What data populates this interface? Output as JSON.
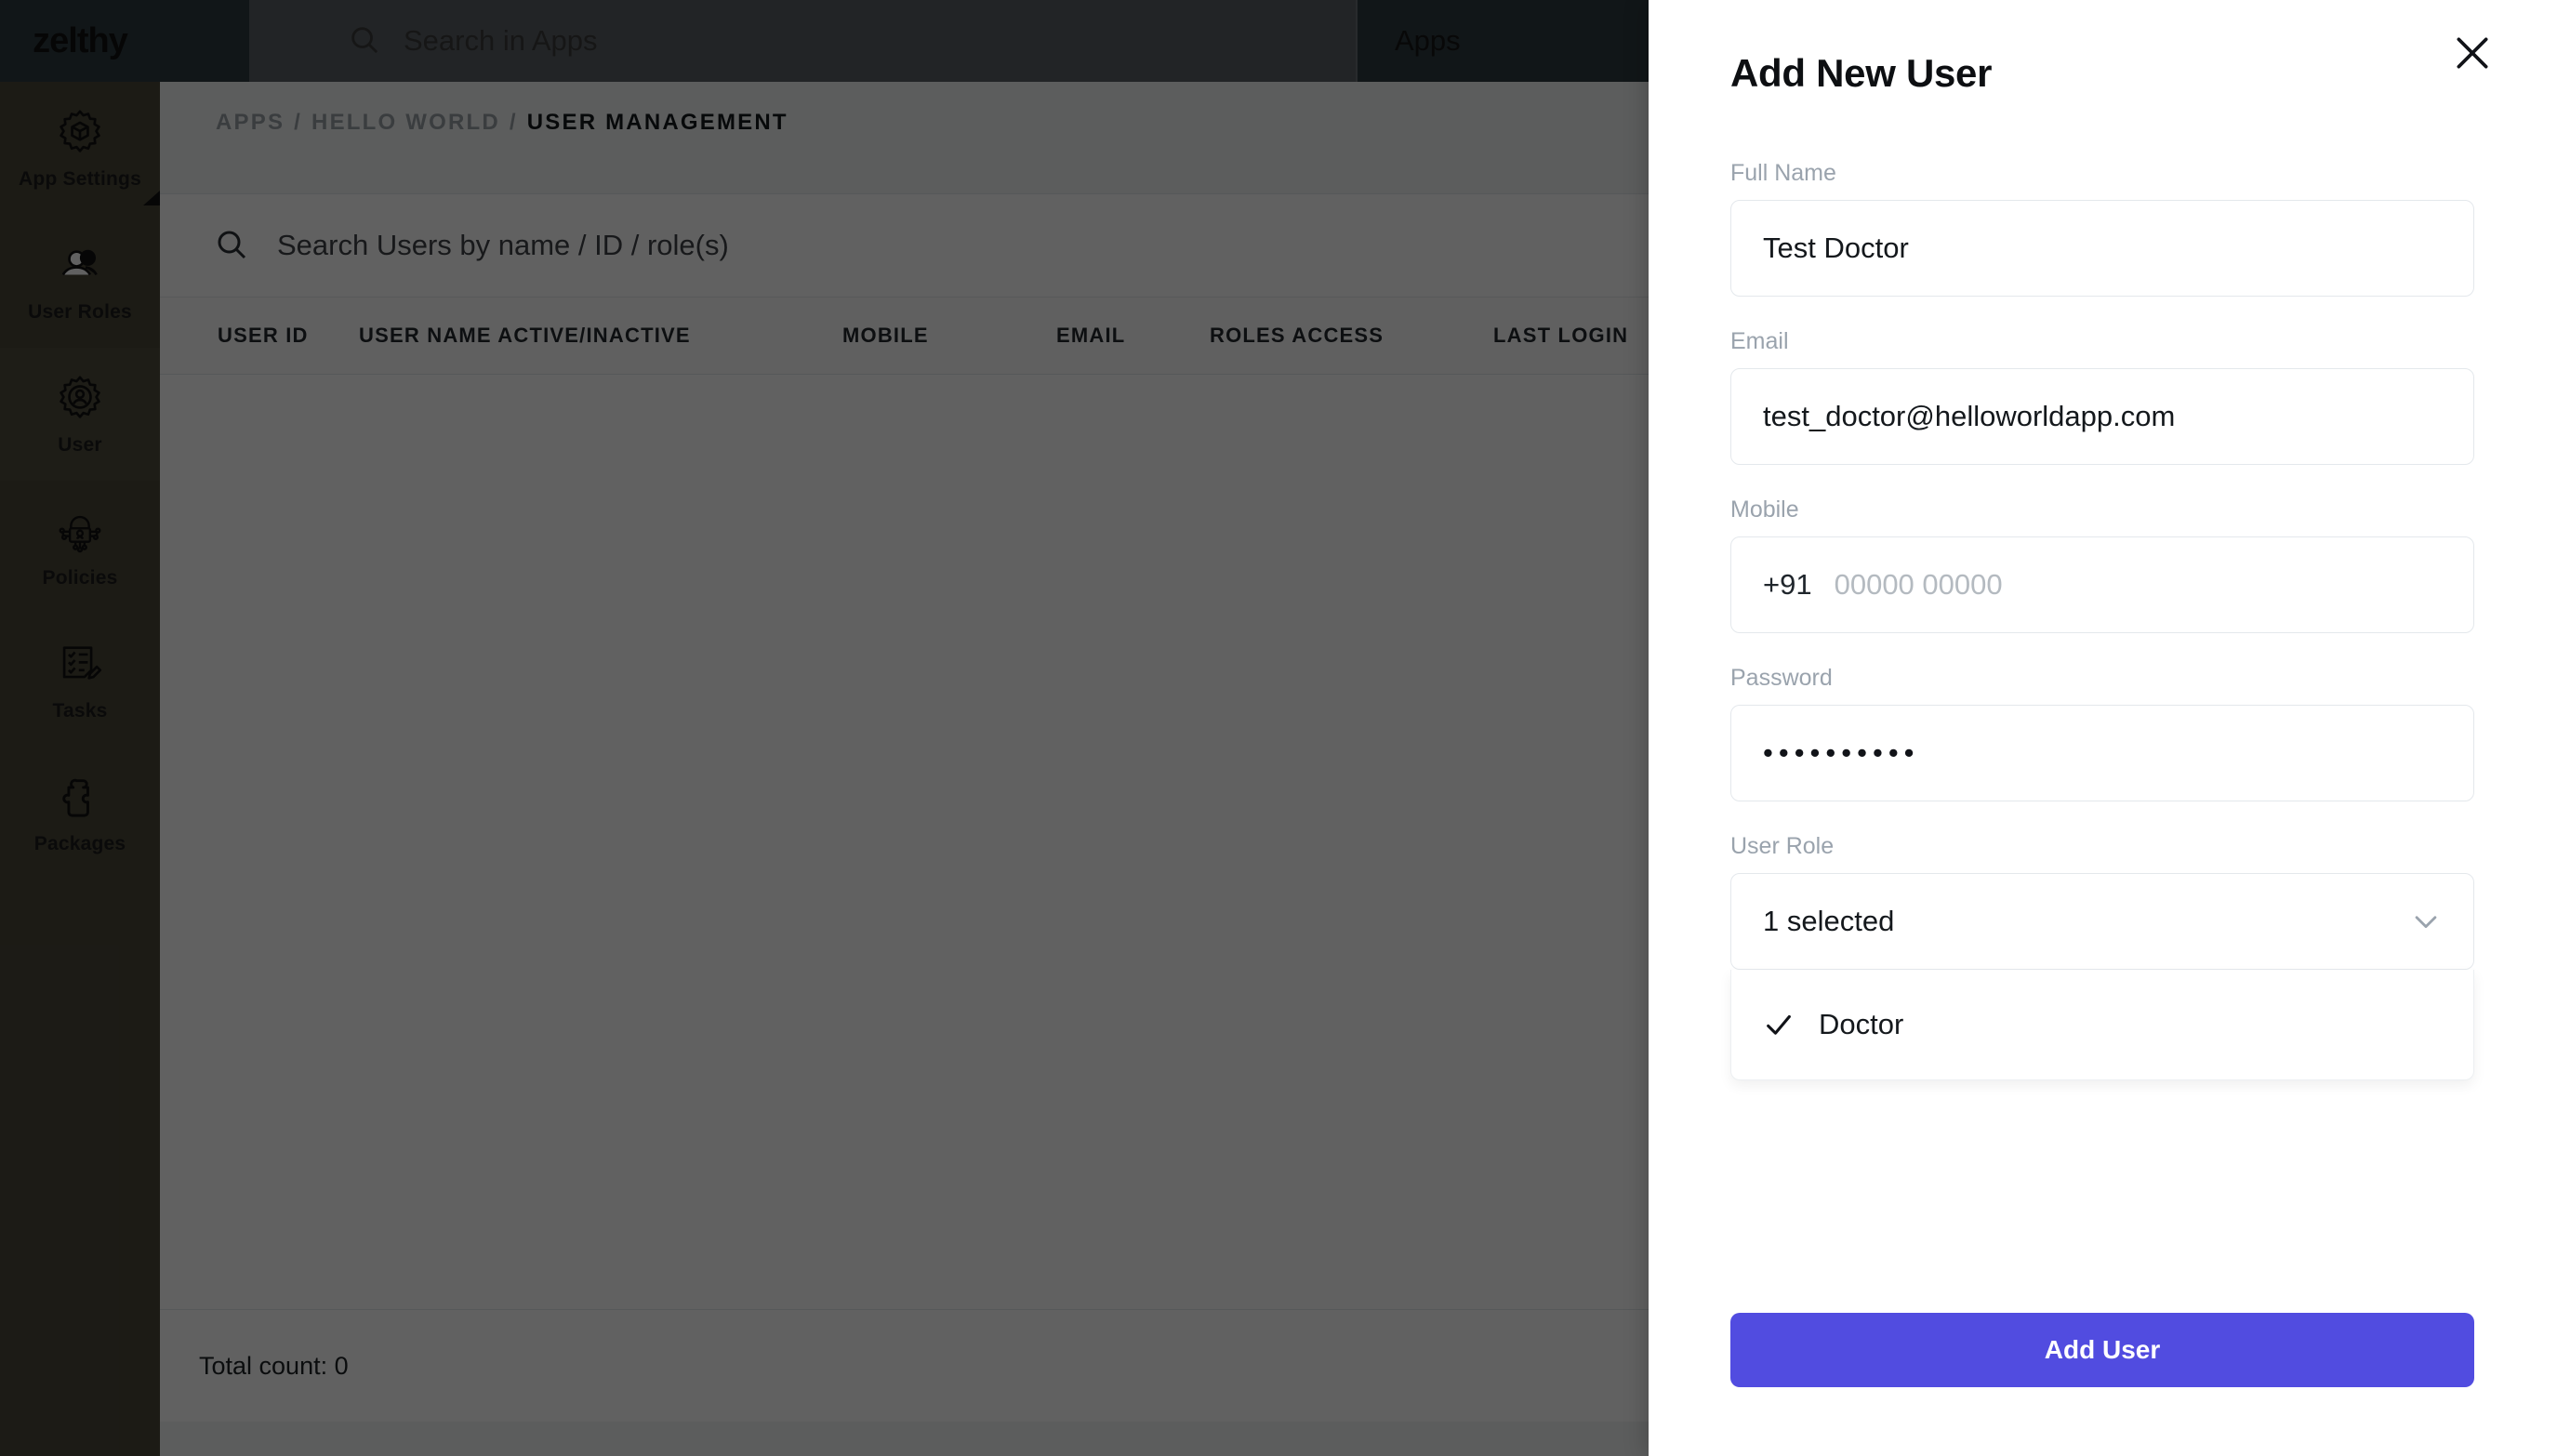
{
  "brand": "zelthy",
  "topbar": {
    "search_placeholder": "Search in Apps",
    "search_icon": "search-icon",
    "apps_label": "Apps"
  },
  "sidebar": {
    "items": [
      {
        "label": "App Settings",
        "icon": "gear-box-icon",
        "active": false,
        "caret": true
      },
      {
        "label": "User Roles",
        "icon": "users-icon",
        "active": false,
        "caret": false
      },
      {
        "label": "User",
        "icon": "gear-user-icon",
        "active": true,
        "caret": false
      },
      {
        "label": "Policies",
        "icon": "policy-shield-icon",
        "active": false,
        "caret": false
      },
      {
        "label": "Tasks",
        "icon": "checklist-pencil-icon",
        "active": false,
        "caret": false
      },
      {
        "label": "Packages",
        "icon": "puzzle-piece-icon",
        "active": false,
        "caret": false
      }
    ]
  },
  "breadcrumb": {
    "apps": "APPS",
    "sep1": "/",
    "app_name": "HELLO WORLD",
    "sep2": "/",
    "current": "USER MANAGEMENT"
  },
  "user_table": {
    "search_placeholder": "Search Users by name / ID / role(s)",
    "search_icon": "search-icon",
    "columns": [
      "USER ID",
      "USER NAME ACTIVE/INACTIVE",
      "MOBILE",
      "EMAIL",
      "ROLES ACCESS",
      "LAST LOGIN"
    ],
    "rows": [],
    "total_count_label": "Total count: 0"
  },
  "panel": {
    "title": "Add New User",
    "close_icon": "close-icon",
    "fields": {
      "full_name": {
        "label": "Full Name",
        "value": "Test Doctor",
        "placeholder": "Full Name"
      },
      "email": {
        "label": "Email",
        "value": "test_doctor@helloworldapp.com",
        "placeholder": "Email"
      },
      "mobile": {
        "label": "Mobile",
        "prefix": "+91",
        "value": "",
        "placeholder": "00000 00000"
      },
      "password": {
        "label": "Password",
        "value": "••••••••••",
        "placeholder": "Password"
      },
      "user_role": {
        "label": "User Role",
        "selected_text": "1 selected",
        "chevron_icon": "chevron-down-icon",
        "options": [
          {
            "label": "Doctor",
            "checked": true,
            "check_icon": "check-icon"
          }
        ]
      }
    },
    "submit_label": "Add User"
  },
  "colors": {
    "accent": "#514CE0",
    "topbar_bg": "#2F3A3F",
    "sidenav_bg": "#4A4739",
    "sidenav_active_bg": "#4F4C3D",
    "scrim": "rgba(0,0,0,0.62)",
    "field_border": "#E4E8EC",
    "label_muted": "#9AA3AD"
  }
}
